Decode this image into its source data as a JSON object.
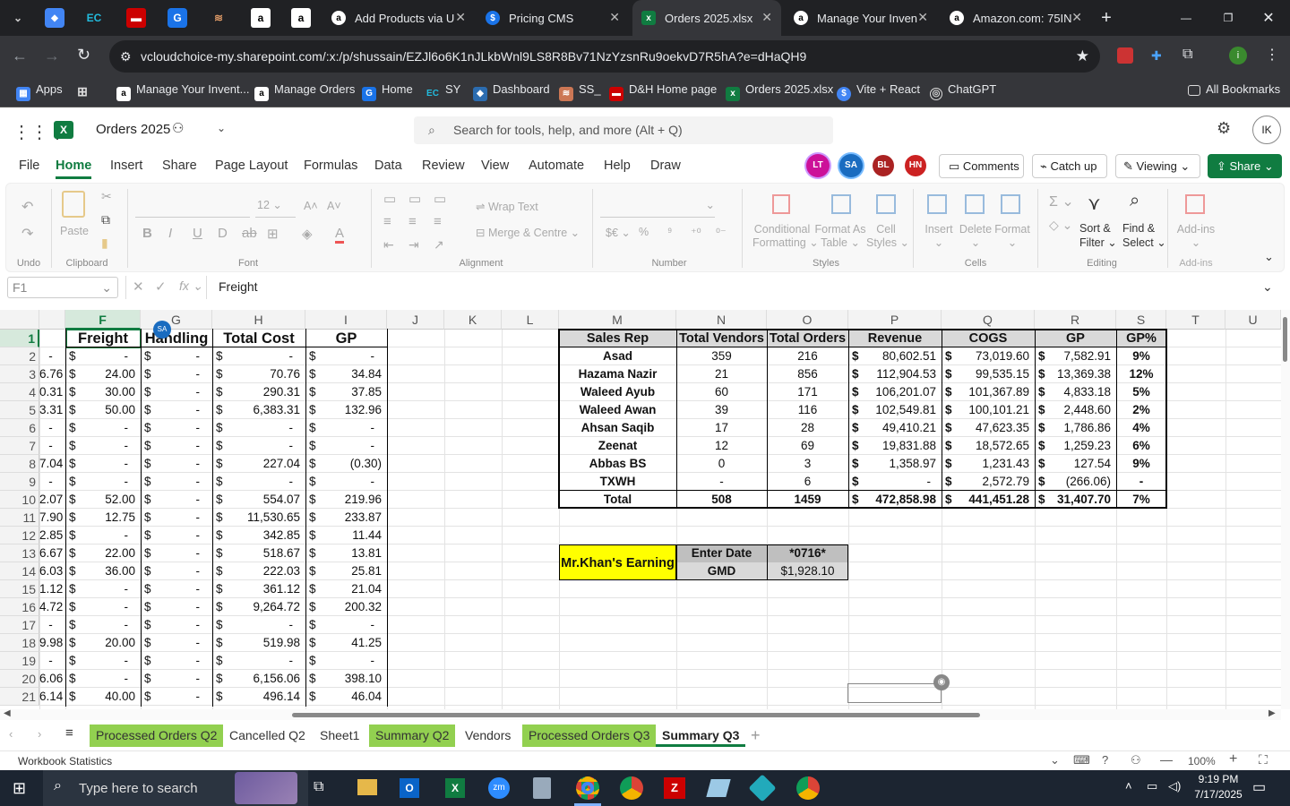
{
  "browser": {
    "tabs": [
      {
        "title": "Add Products via U",
        "icon": "amazon-icon"
      },
      {
        "title": "Pricing CMS",
        "icon": "dollar-icon"
      },
      {
        "title": "Orders 2025.xlsx",
        "icon": "excel-icon",
        "active": true
      },
      {
        "title": "Manage Your Inven",
        "icon": "amazon-icon"
      },
      {
        "title": "Amazon.com: 75IN",
        "icon": "amazon-icon"
      }
    ],
    "url": "vcloudchoice-my.sharepoint.com/:x:/p/shussain/EZJl6o6K1nJLkbWnl9LS8R8Bv71NzYzsnRu9oekvD7R5hA?e=dHaQH9",
    "bookmarks": [
      "Apps",
      "Manage Your Invent...",
      "Manage Orders",
      "Home",
      "SY",
      "Dashboard",
      "SS_",
      "D&H Home page",
      "Orders 2025.xlsx",
      "Vite + React",
      "ChatGPT"
    ],
    "all_bookmarks": "All Bookmarks",
    "pinned": [
      "EC",
      "SA"
    ]
  },
  "excel": {
    "doc_title": "Orders 2025",
    "search_placeholder": "Search for tools, help, and more (Alt + Q)",
    "avatar": "IK",
    "menu": [
      "File",
      "Home",
      "Insert",
      "Share",
      "Page Layout",
      "Formulas",
      "Data",
      "Review",
      "View",
      "Automate",
      "Help",
      "Draw"
    ],
    "collaborators": [
      "LT",
      "SA",
      "BL",
      "HN"
    ],
    "comments_label": "Comments",
    "catchup_label": "Catch up",
    "viewing_label": "Viewing",
    "share_label": "Share",
    "ribbon": {
      "groups": [
        "Undo",
        "Clipboard",
        "Font",
        "Alignment",
        "Number",
        "Styles",
        "Cells",
        "Editing",
        "Add-ins"
      ],
      "paste": "Paste",
      "font_size": "12",
      "wrap": "Wrap Text",
      "merge": "Merge & Centre",
      "cond1": "Conditional",
      "cond2": "Formatting",
      "fmt1": "Format As",
      "fmt2": "Table",
      "cs1": "Cell",
      "cs2": "Styles",
      "insert": "Insert",
      "delete": "Delete",
      "format": "Format",
      "sort1": "Sort &",
      "sort2": "Filter",
      "find1": "Find &",
      "find2": "Select",
      "addins": "Add-ins"
    },
    "namebox": "F1",
    "formula": "Freight",
    "columns": [
      "F",
      "G",
      "H",
      "I",
      "J",
      "K",
      "L",
      "M",
      "N",
      "O",
      "P",
      "Q",
      "R",
      "S",
      "T",
      "U"
    ],
    "rows": [
      "1",
      "2",
      "3",
      "4",
      "5",
      "6",
      "7",
      "8",
      "9",
      "10",
      "11",
      "12",
      "13",
      "14",
      "15",
      "16",
      "17",
      "18",
      "19",
      "20",
      "21"
    ],
    "left_headers": [
      "Freight",
      "Handling",
      "Total Cost",
      "GP"
    ],
    "left_rows": [
      [
        "-",
        "-",
        "-",
        "-",
        "-"
      ],
      [
        "6.76",
        "24.00",
        "-",
        "70.76",
        "34.84"
      ],
      [
        "0.31",
        "30.00",
        "-",
        "290.31",
        "37.85"
      ],
      [
        "3.31",
        "50.00",
        "-",
        "6,383.31",
        "132.96"
      ],
      [
        "-",
        "-",
        "-",
        "-",
        "-"
      ],
      [
        "-",
        "-",
        "-",
        "-",
        "-"
      ],
      [
        "7.04",
        "-",
        "-",
        "227.04",
        "(0.30)"
      ],
      [
        "-",
        "-",
        "-",
        "-",
        "-"
      ],
      [
        "2.07",
        "52.00",
        "-",
        "554.07",
        "219.96"
      ],
      [
        "7.90",
        "12.75",
        "-",
        "11,530.65",
        "233.87"
      ],
      [
        "2.85",
        "-",
        "-",
        "342.85",
        "11.44"
      ],
      [
        "6.67",
        "22.00",
        "-",
        "518.67",
        "13.81"
      ],
      [
        "6.03",
        "36.00",
        "-",
        "222.03",
        "25.81"
      ],
      [
        "1.12",
        "-",
        "-",
        "361.12",
        "21.04"
      ],
      [
        "4.72",
        "-",
        "-",
        "9,264.72",
        "200.32"
      ],
      [
        "-",
        "-",
        "-",
        "-",
        "-"
      ],
      [
        "9.98",
        "20.00",
        "-",
        "519.98",
        "41.25"
      ],
      [
        "-",
        "-",
        "-",
        "-",
        "-"
      ],
      [
        "6.06",
        "-",
        "-",
        "6,156.06",
        "398.10"
      ],
      [
        "6.14",
        "40.00",
        "-",
        "496.14",
        "46.04"
      ]
    ],
    "summary_headers": [
      "Sales Rep",
      "Total Vendors",
      "Total Orders",
      "Revenue",
      "COGS",
      "GP",
      "GP%"
    ],
    "summary_rows": [
      [
        "Asad",
        "359",
        "216",
        "80,602.51",
        "73,019.60",
        "7,582.91",
        "9%"
      ],
      [
        "Hazama Nazir",
        "21",
        "856",
        "112,904.53",
        "99,535.15",
        "13,369.38",
        "12%"
      ],
      [
        "Waleed Ayub",
        "60",
        "171",
        "106,201.07",
        "101,367.89",
        "4,833.18",
        "5%"
      ],
      [
        "Waleed Awan",
        "39",
        "116",
        "102,549.81",
        "100,101.21",
        "2,448.60",
        "2%"
      ],
      [
        "Ahsan Saqib",
        "17",
        "28",
        "49,410.21",
        "47,623.35",
        "1,786.86",
        "4%"
      ],
      [
        "Zeenat",
        "12",
        "69",
        "19,831.88",
        "18,572.65",
        "1,259.23",
        "6%"
      ],
      [
        "Abbas BS",
        "0",
        "3",
        "1,358.97",
        "1,231.43",
        "127.54",
        "9%"
      ],
      [
        "TXWH",
        "-",
        "6",
        "-",
        "2,572.79",
        "(266.06)",
        "-"
      ],
      [
        "Total",
        "508",
        "1459",
        "472,858.98",
        "441,451.28",
        "31,407.70",
        "7%"
      ]
    ],
    "earning_label": "Mr.Khan's Earning",
    "enter_date_label": "Enter Date",
    "enter_date_value": "*0716*",
    "gmd_label": "GMD",
    "gmd_value": "$1,928.10",
    "sheets": [
      "Processed Orders Q2",
      "Cancelled Q2",
      "Sheet1",
      "Summary Q2",
      "Vendors",
      "Processed Orders Q3",
      "Summary Q3"
    ],
    "workbook_stats": "Workbook Statistics",
    "zoom": "100%"
  },
  "taskbar": {
    "search": "Type here to search",
    "time": "9:19 PM",
    "date": "7/17/2025"
  },
  "colors": {
    "excel_green": "#107c41",
    "highlight_green": "#92d050",
    "yellow": "#ffff00",
    "gray": "#d9d9d9"
  }
}
